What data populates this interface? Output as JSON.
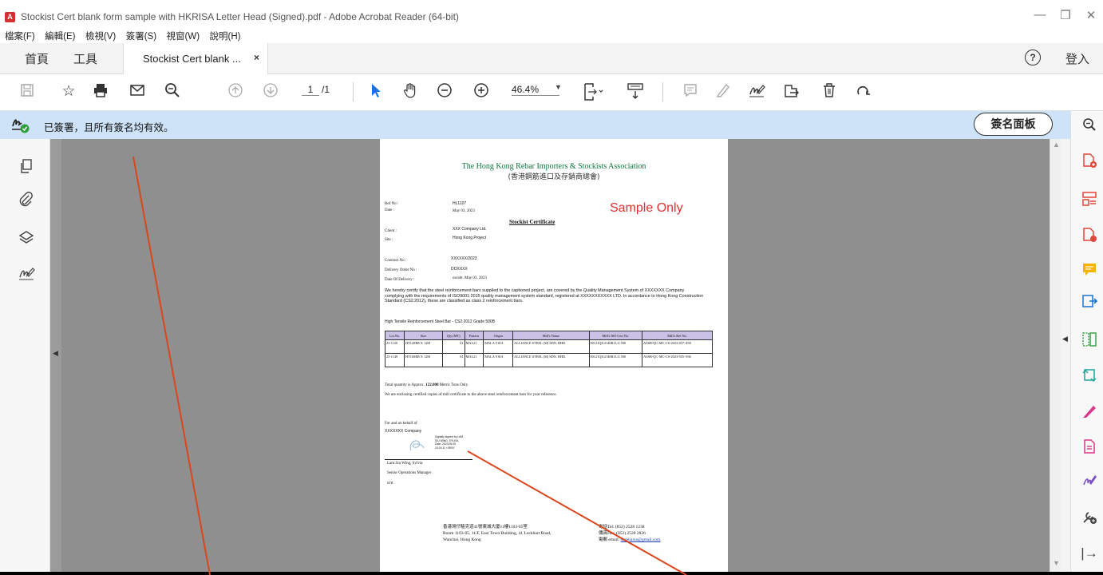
{
  "window": {
    "title": "Stockist Cert blank form sample with HKRISA Letter Head (Signed).pdf - Adobe Acrobat Reader (64-bit)",
    "minimize": "—",
    "restore": "❐",
    "close": "✕"
  },
  "menu": [
    "檔案(F)",
    "編輯(E)",
    "檢視(V)",
    "簽署(S)",
    "視窗(W)",
    "說明(H)"
  ],
  "tabs": {
    "home": "首頁",
    "tools": "工具",
    "document": "Stockist Cert blank ...",
    "close": "×",
    "help": "?",
    "login": "登入"
  },
  "toolbar": {
    "page_current": "1",
    "page_total": "/1",
    "zoom": "46.4%"
  },
  "signature_bar": {
    "message": "已簽署，且所有簽名均有效。",
    "panel_button": "簽名面板"
  },
  "document": {
    "assoc_en": "The Hong Kong Rebar Importers & Stockists Association",
    "assoc_zh": "(香港鋼筋進口及存銷商總會)",
    "ref_label": "Ref No :",
    "ref_value": "HL1107",
    "date_label": "Date :",
    "date_value": "May 03, 2023",
    "watermark": "Sample Only",
    "cert_title": "Stockist Certificate",
    "client_label": "Client :",
    "client_value": "XXX Company Ltd.",
    "site_label": "Site :",
    "site_value": "Hong Kong Project",
    "contract_label": "Contract No :",
    "contract_value": "XXXXXX/2023",
    "do_label": "Delivery Order No :",
    "do_value": "DOXXXX",
    "dod_label": "Date Of Delivery :",
    "dod_value": "on/abt. May 03, 2023",
    "paragraph": "We hereby certify that the steel reinforcement bars supplied to the captioned project, are covered by the Quality Management System of    XXXXXXX Company       complying with the requirements of ISO9001:2015 quality management system standard, registered at    XXXXXXXXXXX LTD.          In accordance to Hong Kong Construction Standard (CS2:2012), these are classified as class 2 reinforcement bars.",
    "steel_heading": "High Tensile Reinforcement Steel Bar - CS2:2012 Grade 500B",
    "table_headers": [
      "Lot No.",
      "Size",
      "Qty (MT)",
      "Pattern",
      "Origin",
      "Mill's Name",
      "Mill's ISO Cert No.",
      "Mill's Ref No."
    ],
    "table_rows": [
      [
        "23-1120",
        "HT12MM X 12M",
        "61",
        "MAL21",
        "MALA YSIA",
        "ALLIANCE STEEL (M) SDN. BHD.",
        "00121QI12146R1L/4 500",
        "ASSB-QC-MC-CS-2023-457~458"
      ],
      [
        "23-1149",
        "HT16MM X 12M",
        "61",
        "MAL21",
        "MALA YSIA",
        "ALLIANCE STEEL (M) SDN. BHD.",
        "00121QI12146R1L/4 500",
        "ASSB-QC-MC-CS-2023-505~506"
      ]
    ],
    "total_prefix": "Total quantity is Approx.",
    "total_value": "122.000",
    "total_suffix": "Metric Tons Only.",
    "enclosing": "We are enclosing certified copies of mill certificate to the above steel reinforcement bars for your reference.",
    "behalf": "For and on behalf of",
    "company": "XXXXXXX Company",
    "digital_sig": [
      "Digitally signed by LAM",
      "SIU WING, SYLVIA",
      "Date: 2023.05.05",
      "15:24:11 +08'00'"
    ],
    "signer_name": "Lam Siu Wing, Sylvia",
    "signer_title": "Senior Operations Manager",
    "initials": "sl/tl",
    "addr_zh": "香港灣仔駱克道41號東城大廈11樓1103-05室",
    "addr_en1": "Room 1103-05, 11/F, East Town Building, 41 Lockhart Road,",
    "addr_en2": "Wanchai, Hong Kong",
    "tel": "電話Tel: (852) 2528 1238",
    "fax": "傳真Fax: (852) 2528 2826",
    "email_label": "電郵 email:",
    "email": "hkrebarsa@gmail.com"
  },
  "colors": {
    "signature_bar": "#cfe3f8",
    "doc_background": "#8f8f8f",
    "accent_blue": "#1473e6",
    "annotation_line": "#d9461b"
  }
}
